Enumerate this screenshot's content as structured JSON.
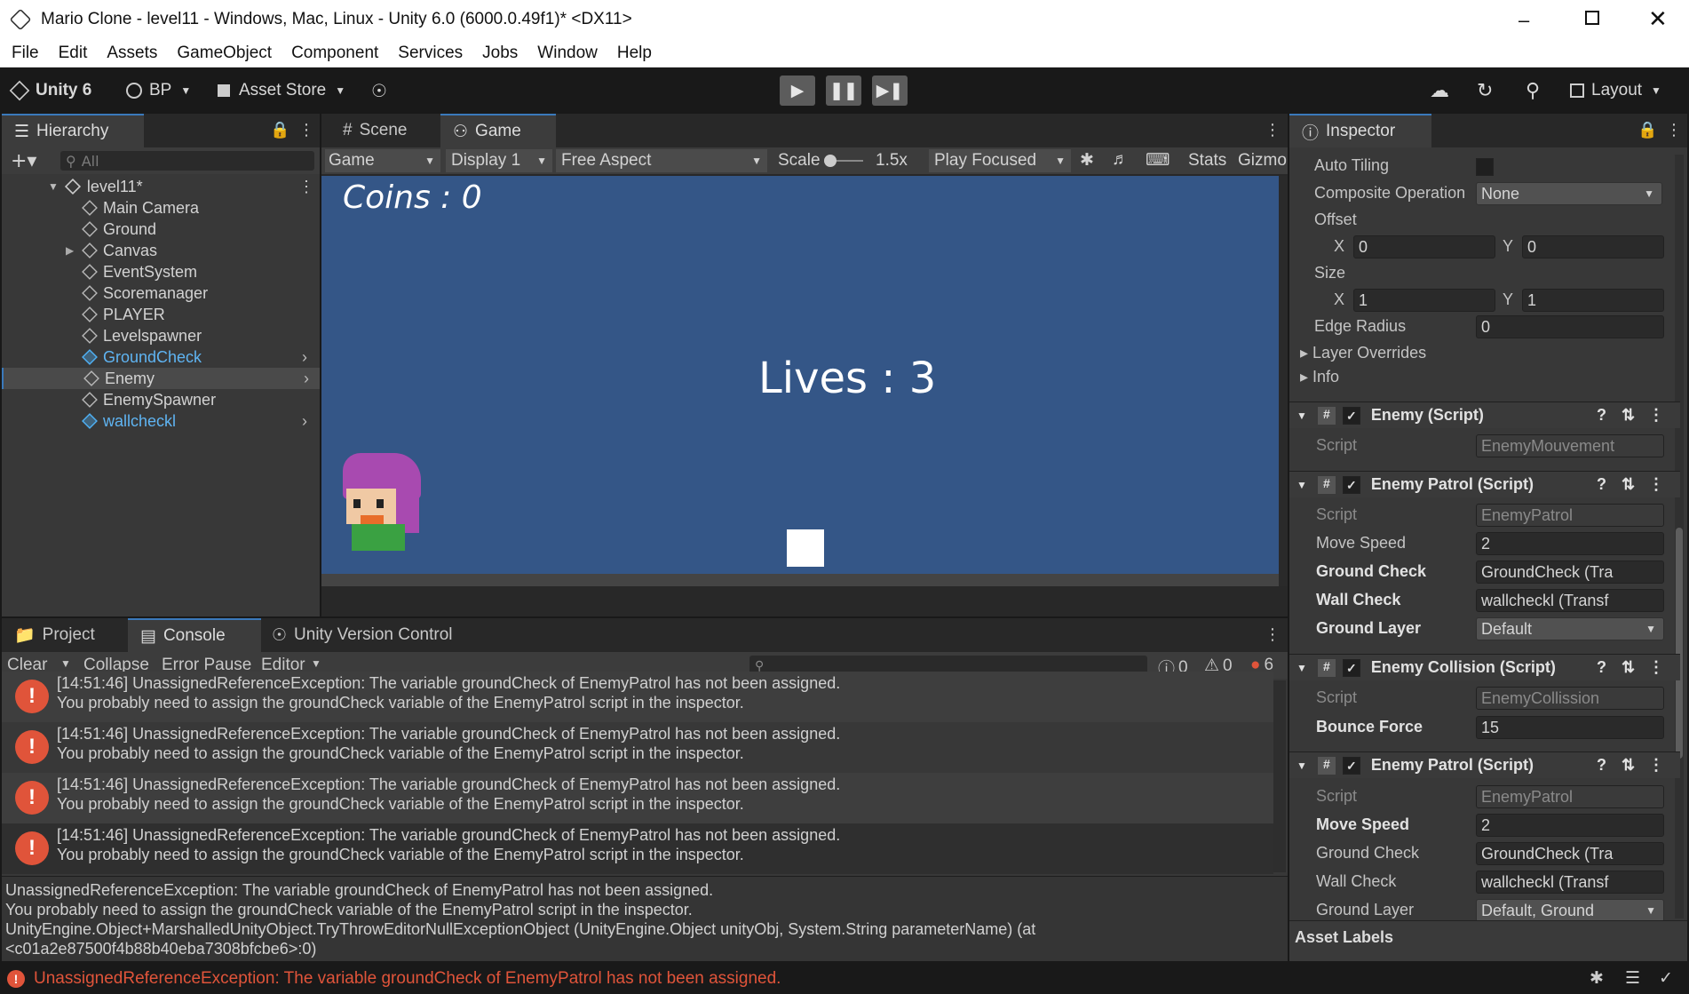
{
  "window": {
    "title": "Mario Clone - level11 - Windows, Mac, Linux - Unity 6.0 (6000.0.49f1)* <DX11>"
  },
  "menu": [
    "File",
    "Edit",
    "Assets",
    "GameObject",
    "Component",
    "Services",
    "Jobs",
    "Window",
    "Help"
  ],
  "toolbar": {
    "unity_label": "Unity 6",
    "account_label": "BP",
    "asset_store_label": "Asset Store",
    "layout_label": "Layout"
  },
  "hierarchy": {
    "tab": "Hierarchy",
    "search_placeholder": "All",
    "scene": "level11*",
    "items": [
      {
        "label": "Main Camera",
        "blue": false
      },
      {
        "label": "Ground",
        "blue": false
      },
      {
        "label": "Canvas",
        "blue": false,
        "foldout": true
      },
      {
        "label": "EventSystem",
        "blue": false
      },
      {
        "label": "Scoremanager",
        "blue": false
      },
      {
        "label": "PLAYER",
        "blue": false
      },
      {
        "label": "Levelspawner",
        "blue": false
      },
      {
        "label": "GroundCheck",
        "blue": true,
        "arrow": true
      },
      {
        "label": "Enemy",
        "blue": false,
        "arrow": true,
        "selected": true
      },
      {
        "label": "EnemySpawner",
        "blue": false
      },
      {
        "label": "wallcheckl",
        "blue": true,
        "arrow": true
      }
    ]
  },
  "game": {
    "tab_scene": "Scene",
    "tab_game": "Game",
    "view_mode": "Game",
    "display": "Display 1",
    "aspect": "Free Aspect",
    "scale_label": "Scale",
    "scale_value": "1.5x",
    "play_mode": "Play Focused",
    "stats": "Stats",
    "gizmos": "Gizmo",
    "coins_text": "Coins : 0",
    "lives_text": "Lives : 3"
  },
  "console": {
    "tab_project": "Project",
    "tab_console": "Console",
    "tab_uvc": "Unity Version Control",
    "clear": "Clear",
    "collapse": "Collapse",
    "error_pause": "Error Pause",
    "editor": "Editor",
    "count_log": "0",
    "count_warn": "0",
    "count_err": "6",
    "entries": [
      {
        "line1": "[14:51:46] UnassignedReferenceException: The variable groundCheck of EnemyPatrol has not been assigned.",
        "line2": "You probably need to assign the groundCheck variable of the EnemyPatrol script in the inspector."
      },
      {
        "line1": "[14:51:46] UnassignedReferenceException: The variable groundCheck of EnemyPatrol has not been assigned.",
        "line2": "You probably need to assign the groundCheck variable of the EnemyPatrol script in the inspector."
      },
      {
        "line1": "[14:51:46] UnassignedReferenceException: The variable groundCheck of EnemyPatrol has not been assigned.",
        "line2": "You probably need to assign the groundCheck variable of the EnemyPatrol script in the inspector."
      },
      {
        "line1": "[14:51:46] UnassignedReferenceException: The variable groundCheck of EnemyPatrol has not been assigned.",
        "line2": "You probably need to assign the groundCheck variable of the EnemyPatrol script in the inspector."
      }
    ],
    "detail": [
      "UnassignedReferenceException: The variable groundCheck of EnemyPatrol has not been assigned.",
      "You probably need to assign the groundCheck variable of the EnemyPatrol script in the inspector.",
      "UnityEngine.Object+MarshalledUnityObject.TryThrowEditorNullExceptionObject (UnityEngine.Object unityObj, System.String parameterName) (at",
      "<c01a2e87500f4b88b40eba7308bfcbe6>:0)"
    ]
  },
  "inspector": {
    "tab": "Inspector",
    "auto_tiling": "Auto Tiling",
    "composite_op_label": "Composite Operation",
    "composite_op_value": "None",
    "offset": "Offset",
    "offset_x": "0",
    "offset_y": "0",
    "size": "Size",
    "size_x": "1",
    "size_y": "1",
    "x": "X",
    "y": "Y",
    "edge_radius_label": "Edge Radius",
    "edge_radius": "0",
    "layer_overrides": "Layer Overrides",
    "info": "Info",
    "c1_title": "Enemy (Script)",
    "c1_script": "EnemyMouvement",
    "c2_title": "Enemy Patrol (Script)",
    "c2_script": "EnemyPatrol",
    "move_speed": "Move Speed",
    "move_speed_v": "2",
    "ground_check": "Ground Check",
    "ground_check_v": "GroundCheck (Tra",
    "wall_check": "Wall Check",
    "wall_check_v": "wallcheckl (Transf",
    "ground_layer": "Ground Layer",
    "ground_layer_v": "Default",
    "c3_title": "Enemy Collision (Script)",
    "c3_script": "EnemyCollission",
    "bounce_force": "Bounce Force",
    "bounce_force_v": "15",
    "c4_title": "Enemy Patrol (Script)",
    "c4_script": "EnemyPatrol",
    "c4_move_v": "2",
    "c4_gc_v": "GroundCheck (Tra",
    "c4_wc_v": "wallcheckl (Transf",
    "c4_gl_v": "Default, Ground",
    "script": "Script",
    "asset_labels": "Asset Labels"
  },
  "status": {
    "message": "UnassignedReferenceException: The variable groundCheck of EnemyPatrol has not been assigned."
  }
}
